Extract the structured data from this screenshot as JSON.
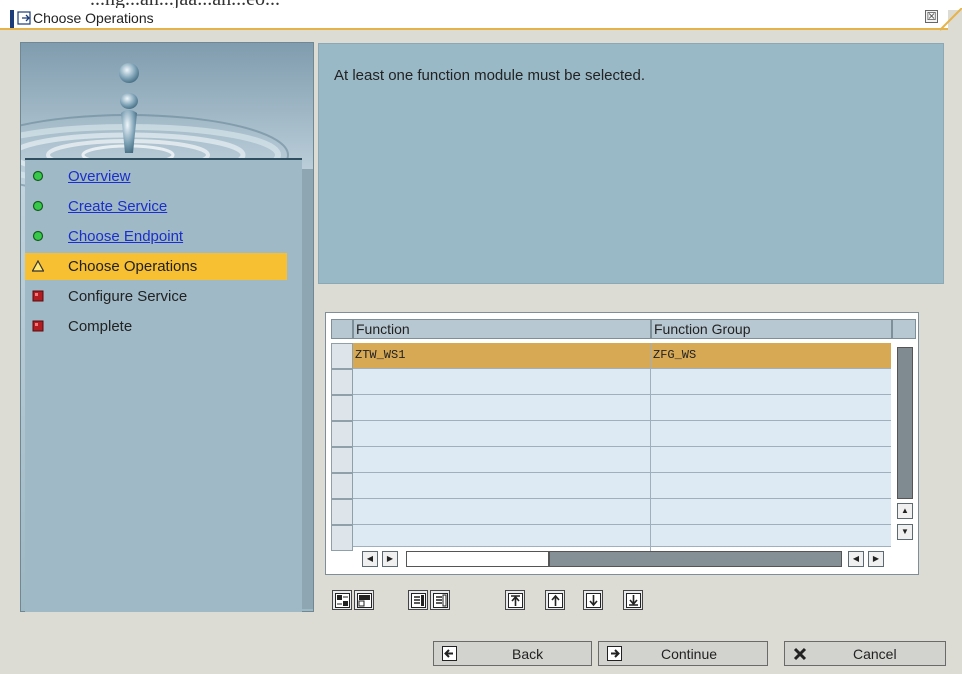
{
  "top_strip_text": "...ng...an...jaa...an...eo...",
  "window": {
    "title": "Choose Operations",
    "close_glyph": "☒"
  },
  "nav": {
    "items": [
      {
        "label": "Overview",
        "status": "done",
        "icon": "green-dot-icon",
        "link": true
      },
      {
        "label": "Create Service",
        "status": "done",
        "icon": "green-dot-icon",
        "link": true
      },
      {
        "label": "Choose Endpoint",
        "status": "done",
        "icon": "green-dot-icon",
        "link": true
      },
      {
        "label": "Choose Operations",
        "status": "current",
        "icon": "warning-triangle-icon",
        "link": false
      },
      {
        "label": "Configure Service",
        "status": "pending",
        "icon": "red-square-icon",
        "link": false
      },
      {
        "label": "Complete",
        "status": "pending",
        "icon": "red-square-icon",
        "link": false
      }
    ]
  },
  "message": "At least one function module must be selected.",
  "table": {
    "columns": [
      "Function",
      "Function Group"
    ],
    "rows": [
      {
        "function": "ZTW_WS1",
        "group": "ZFG_WS",
        "selected": true
      },
      {
        "function": "",
        "group": "",
        "selected": false
      },
      {
        "function": "",
        "group": "",
        "selected": false
      },
      {
        "function": "",
        "group": "",
        "selected": false
      },
      {
        "function": "",
        "group": "",
        "selected": false
      },
      {
        "function": "",
        "group": "",
        "selected": false
      },
      {
        "function": "",
        "group": "",
        "selected": false
      },
      {
        "function": "",
        "group": "",
        "selected": false
      }
    ]
  },
  "toolbar_icons": [
    "select-all-icon",
    "deselect-all-icon",
    "select-block-icon",
    "deselect-block-icon",
    "move-top-icon",
    "move-up-icon",
    "move-down-icon",
    "move-bottom-icon"
  ],
  "footer": {
    "back_label": "Back",
    "continue_label": "Continue",
    "cancel_label": "Cancel"
  },
  "colors": {
    "active_nav": "#f7bf32",
    "selected_row": "#d8a955",
    "link": "#1c2fc8",
    "panel": "#9ab9c7"
  }
}
